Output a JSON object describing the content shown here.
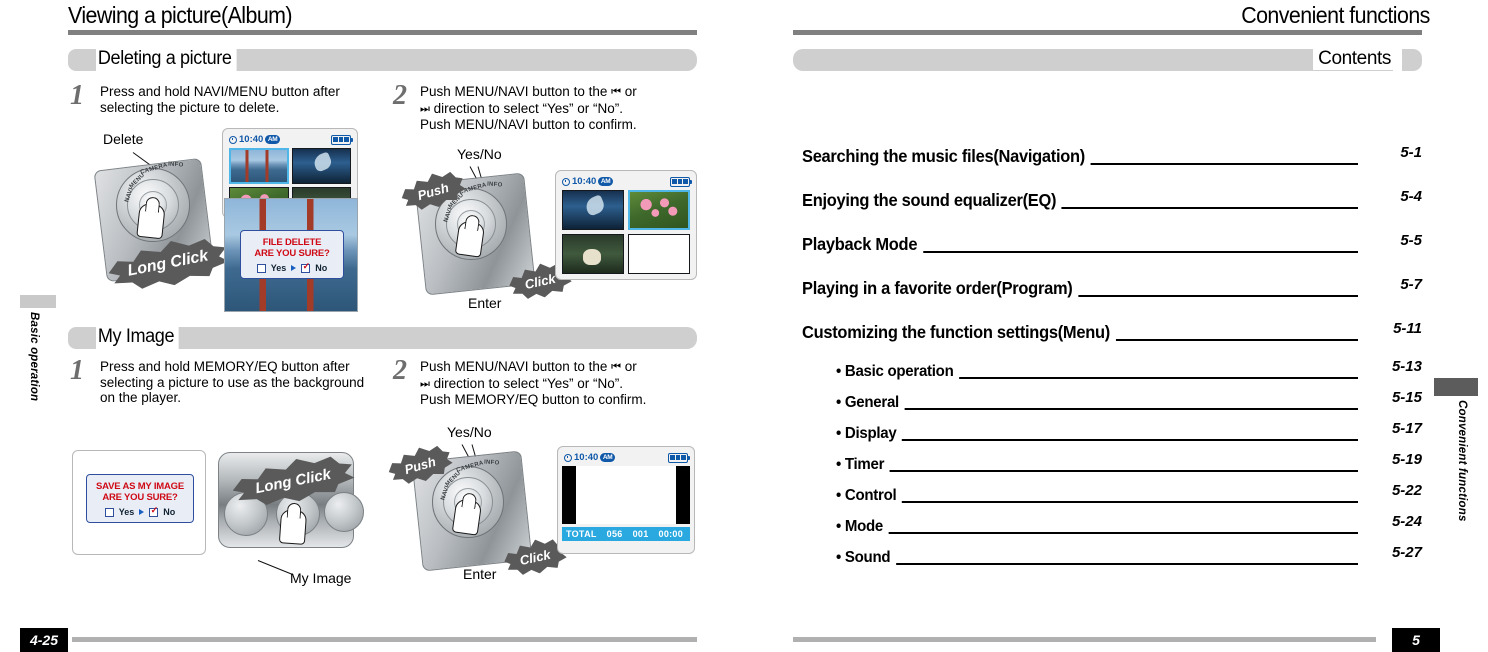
{
  "left_page": {
    "title": "Viewing a picture(Album)",
    "edge_tab": "Basic operation",
    "page_number": "4-25",
    "sections": [
      {
        "heading": "Deleting a picture",
        "steps": [
          {
            "number": "1",
            "text_line1": "Press and hold NAVI/MENU button after",
            "text_line2": "selecting the picture to delete.",
            "callouts": [
              "Delete",
              "Long Click"
            ]
          },
          {
            "number": "2",
            "text_line1": "Push MENU/NAVI button to the",
            "text_line1_glyph": "⏮",
            "text_line1_tail": "or",
            "text_line2_glyph": "⏭",
            "text_line2": "direction to select “Yes” or “No”.",
            "text_line3": "Push MENU/NAVI button to confirm.",
            "callouts": [
              "Yes/No",
              "Push",
              "Enter",
              "Click"
            ]
          }
        ]
      },
      {
        "heading": "My Image",
        "steps": [
          {
            "number": "1",
            "text_line1": "Press and hold MEMORY/EQ button after",
            "text_line2": "selecting a picture to use as the background",
            "text_line3": "on the player.",
            "callouts": [
              "Long Click",
              "My Image"
            ]
          },
          {
            "number": "2",
            "text_line1": "Push MENU/NAVI button to the",
            "text_line1_glyph": "⏮",
            "text_line1_tail": "or",
            "text_line2_glyph": "⏭",
            "text_line2": "direction to select “Yes” or “No”.",
            "text_line3": "Push MEMORY/EQ button to confirm.",
            "callouts": [
              "Yes/No",
              "Push",
              "Enter",
              "Click"
            ]
          }
        ]
      }
    ],
    "lcd_screens": {
      "clock_time": "10:40",
      "clock_meridiem": "AM",
      "delete_dialog": {
        "line1": "FILE DELETE",
        "line2": "ARE YOU SURE?",
        "option_yes": "Yes",
        "option_no": "No",
        "selected": "No"
      },
      "myimage_dialog": {
        "line1": "SAVE AS MY IMAGE",
        "line2": "ARE YOU SURE?",
        "option_yes": "Yes",
        "option_no": "No",
        "selected": "No"
      },
      "total_bar": {
        "label": "TOTAL",
        "total": "056",
        "track": "001",
        "time": "00:00"
      }
    },
    "device_ring_labels": [
      "NAVI",
      "MENU",
      "CAMERA",
      "INFO"
    ]
  },
  "right_page": {
    "title": "Convenient functions",
    "edge_tab": "Convenient functions",
    "page_number": "5",
    "contents_heading": "Contents",
    "contents": [
      {
        "label": "Searching the music files(Navigation)",
        "page": "5-1",
        "sub": false
      },
      {
        "label": "Enjoying the sound equalizer(EQ)",
        "page": "5-4",
        "sub": false
      },
      {
        "label": "Playback Mode",
        "page": "5-5",
        "sub": false
      },
      {
        "label": "Playing in a favorite order(Program)",
        "page": "5-7",
        "sub": false
      },
      {
        "label": "Customizing the function settings(Menu)",
        "page": "5-11",
        "sub": false
      },
      {
        "label": "• Basic operation",
        "page": "5-13",
        "sub": true
      },
      {
        "label": "• General",
        "page": "5-15",
        "sub": true
      },
      {
        "label": "• Display",
        "page": "5-17",
        "sub": true
      },
      {
        "label": "• Timer",
        "page": "5-19",
        "sub": true
      },
      {
        "label": "• Control",
        "page": "5-22",
        "sub": true
      },
      {
        "label": "• Mode",
        "page": "5-24",
        "sub": true
      },
      {
        "label": "• Sound",
        "page": "5-27",
        "sub": true
      }
    ]
  },
  "colors": {
    "rule_gray": "#808080",
    "bar_gray": "#cfcfcf",
    "dialog_red": "#cf0a16",
    "lcd_blue": "#1058a8",
    "total_blue": "#2aa8e0",
    "tab_dark": "#5c5c5c"
  }
}
